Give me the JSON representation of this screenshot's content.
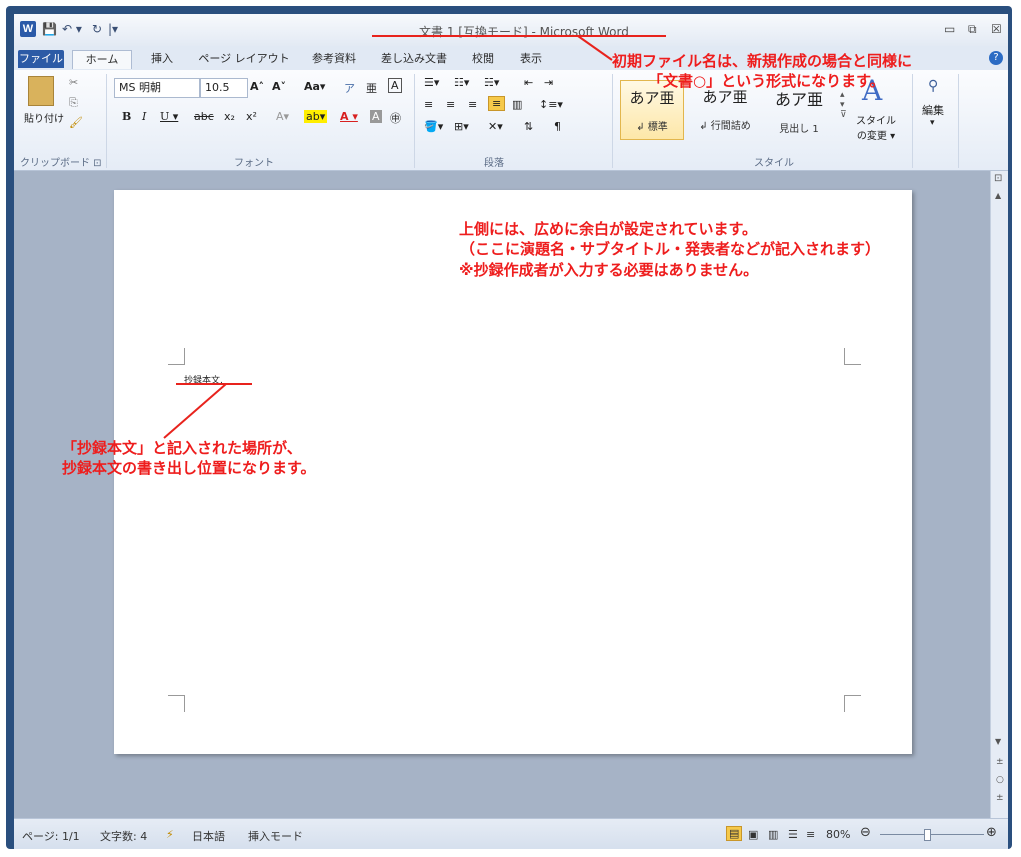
{
  "window": {
    "title": "文書 1 [互換モード] - Microsoft Word"
  },
  "quick_access": {
    "app_icon_letter": "W",
    "save": "💾",
    "undo": "↶ ▾",
    "redo": "↻",
    "customize": "|▾"
  },
  "window_buttons": {
    "minimize": "▭",
    "restore": "⧉",
    "close": "☒"
  },
  "tabs": [
    "ファイル",
    "ホーム",
    "挿入",
    "ページ レイアウト",
    "参考資料",
    "差し込み文書",
    "校閲",
    "表示"
  ],
  "ribbon": {
    "clipboard": {
      "paste": "貼り付け",
      "label": "クリップボード ⊡"
    },
    "font": {
      "name": "MS 明朝",
      "size": "10.5",
      "grow": "A˄",
      "shrink": "A˅",
      "case": "Aa▾",
      "bold": "B",
      "italic": "I",
      "underline": "U ▾",
      "strike": "abc",
      "sub": "x₂",
      "sup": "x²",
      "label": "フォント"
    },
    "paragraph": {
      "label": "段落"
    },
    "styles": {
      "items": [
        {
          "preview": "あア亜",
          "name": "↲ 標準"
        },
        {
          "preview": "あア亜",
          "name": "↲ 行間詰め"
        },
        {
          "preview": "あア亜",
          "name": "見出し 1"
        }
      ],
      "change": "スタイルの変更 ▾",
      "label": "スタイル"
    },
    "editing": {
      "label": "編集"
    }
  },
  "document": {
    "body_text": "抄録本文."
  },
  "status_bar": {
    "page": "ページ: 1/1",
    "words": "文字数: 4",
    "language": "日本語",
    "mode": "挿入モード",
    "zoom": "80%"
  },
  "annotations": {
    "filename_note": "初期ファイル名は、新規作成の場合と同様に",
    "filename_note2": "「文書○」という形式になります。",
    "margin_note1": "上側には、広めに余白が設定されています。",
    "margin_note2": "（ここに演題名・サブタイトル・発表者などが記入されます）",
    "margin_note3": "※抄録作成者が入力する必要はありません。",
    "start_note1": "「抄録本文」と記入された場所が、",
    "start_note2": "抄録本文の書き出し位置になります。"
  },
  "colors": {
    "annotation": "#ee1d1d",
    "file_tab": "#2c5ba6"
  }
}
